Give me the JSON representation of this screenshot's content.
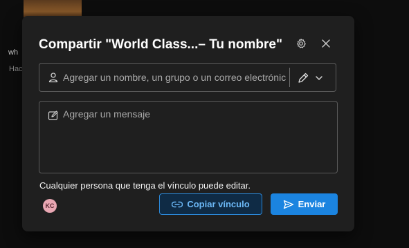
{
  "background": {
    "text1": "wh",
    "text2": "Hac"
  },
  "dialog": {
    "title": "Compartir \"World Class...– Tu nombre\"",
    "icons": {
      "gear": "gear-icon",
      "close": "close-icon"
    },
    "recipient": {
      "placeholder": "Agregar un nombre, un grupo o un correo electrónico",
      "value": ""
    },
    "permission": {
      "icon": "pencil-icon",
      "dropdown": "chevron-down-icon"
    },
    "message": {
      "placeholder": "Agregar un mensaje",
      "value": ""
    },
    "note": "Cualquier persona que tenga el vínculo puede editar.",
    "avatar_initials": "KC",
    "copy_link_label": "Copiar vínculo",
    "send_label": "Enviar"
  },
  "colors": {
    "dialog_bg": "#1f1f1f",
    "accent": "#1b84e0",
    "link": "#6cb8f6",
    "avatar_bg": "#e9a7b3"
  }
}
